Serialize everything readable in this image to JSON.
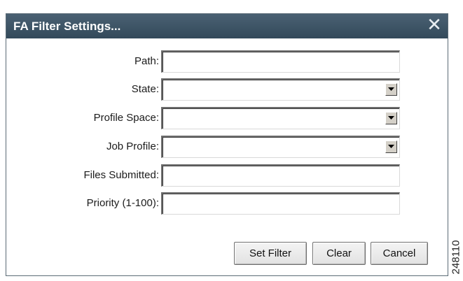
{
  "dialog": {
    "title": "FA Filter Settings...",
    "close_glyph": "✕",
    "fields": [
      {
        "label": "Path:",
        "type": "text",
        "value": ""
      },
      {
        "label": "State:",
        "type": "combo",
        "value": ""
      },
      {
        "label": "Profile Space:",
        "type": "combo",
        "value": ""
      },
      {
        "label": "Job Profile:",
        "type": "combo",
        "value": ""
      },
      {
        "label": "Files Submitted:",
        "type": "text",
        "value": ""
      },
      {
        "label": "Priority (1-100):",
        "type": "text",
        "value": ""
      }
    ],
    "buttons": {
      "set_filter": "Set Filter",
      "clear": "Clear",
      "cancel": "Cancel"
    }
  },
  "figure_id": "248110",
  "colors": {
    "titlebar": "#3d5466",
    "title_text": "#ffffff",
    "dialog_bg": "#ffffff"
  }
}
